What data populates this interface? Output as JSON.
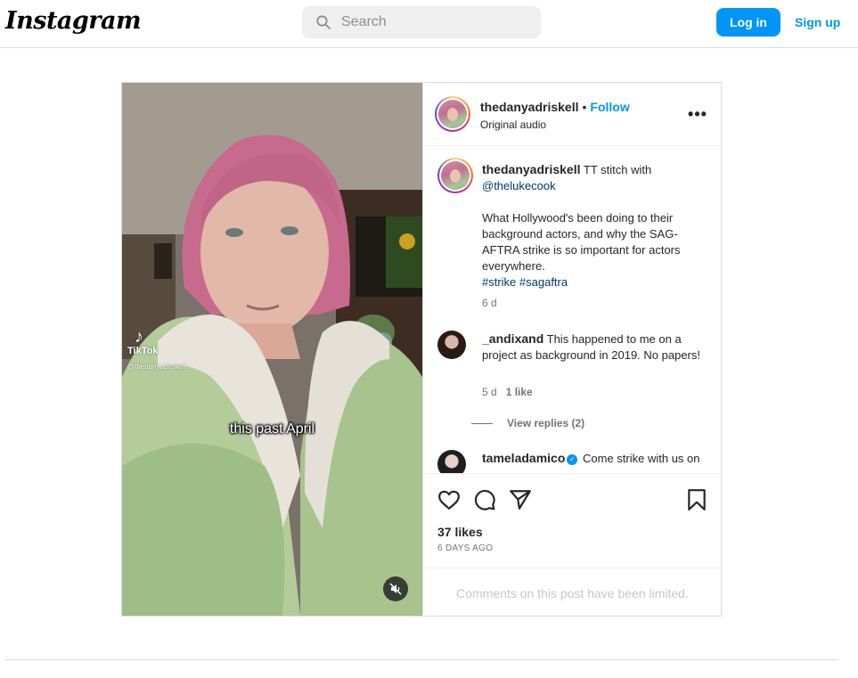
{
  "header": {
    "logo": "Instagram",
    "search_placeholder": "Search",
    "login_label": "Log in",
    "signup_label": "Sign up",
    "accent_color": "#0095f6"
  },
  "post": {
    "author": "thedanyadriskell",
    "follow_label": "Follow",
    "separator": "•",
    "audio": "Original audio",
    "more_icon": "more-horizontal-icon",
    "video": {
      "watermark": "TikTok",
      "watermark_handle": "@thedanyadriskell",
      "caption_overlay": "this past April",
      "mute_icon": "muted-speaker-icon"
    },
    "caption": {
      "author": "thedanyadriskell",
      "lead": "TT stitch with",
      "mention": "@thelukecook",
      "body": "What Hollywood's been doing to their background actors, and why the SAG-AFTRA strike is so important for actors everywhere.",
      "hashtags": "#strike #sagaftra",
      "age": "6 d"
    },
    "comments": [
      {
        "author": "_andixand",
        "text": "This happened to me on a project as background in 2019. No papers!",
        "age": "5 d",
        "likes": "1 like",
        "replies": "View replies (2)"
      },
      {
        "author": "tameladamico",
        "verified": true,
        "text": "Come strike with us on"
      }
    ],
    "actions": {
      "like_icon": "heart-icon",
      "comment_icon": "comment-bubble-icon",
      "share_icon": "send-plane-icon",
      "save_icon": "bookmark-icon"
    },
    "likes": "37 likes",
    "date": "6 DAYS AGO",
    "comments_limited": "Comments on this post have been limited."
  }
}
